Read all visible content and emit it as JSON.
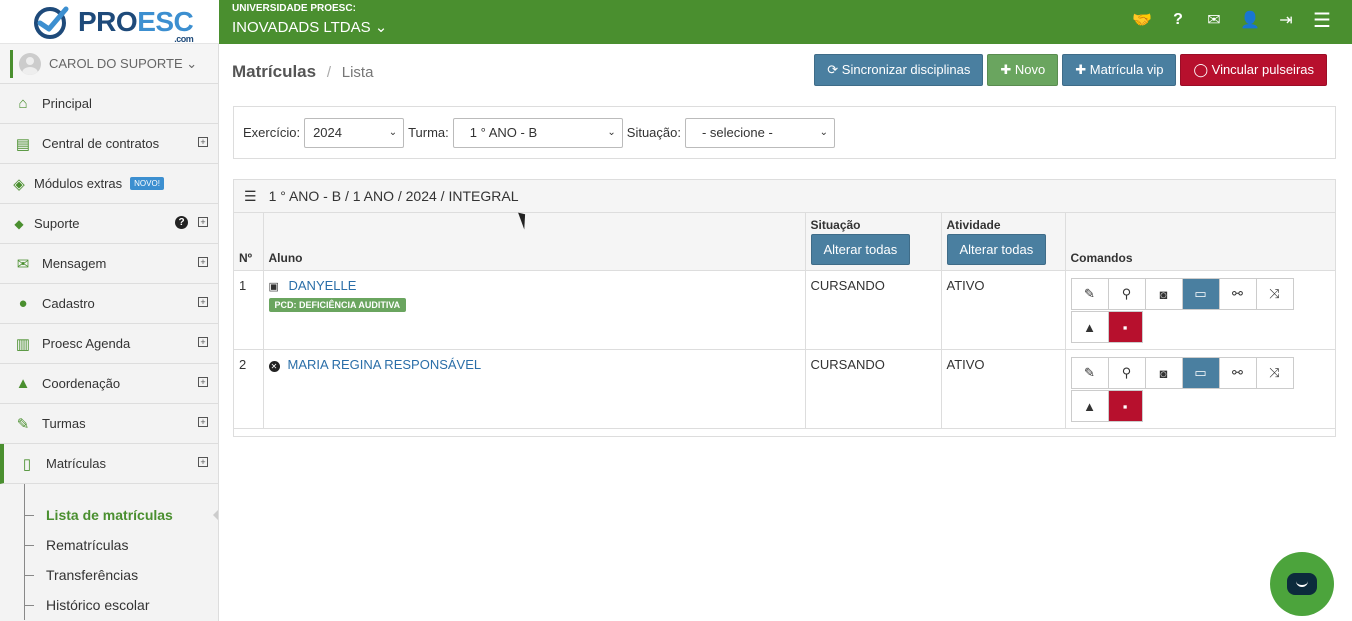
{
  "header": {
    "logo_text_a": "PRO",
    "logo_text_b": "ESC",
    "logo_sub": ".com",
    "org_label": "UNIVERSIDADE PROESC:",
    "org_name": "INOVADADS LTDAS ⌄",
    "icons": [
      "handshake-icon",
      "question-icon",
      "envelope-icon",
      "user-icon",
      "sign-out-icon",
      "menu-icon"
    ],
    "icon_glyphs": [
      "🤝",
      "?",
      "✉",
      "👤",
      "⇥",
      "☰"
    ]
  },
  "sidebar": {
    "user_name": "CAROL DO SUPORTE ⌄",
    "items": [
      {
        "label": "Principal",
        "glyph": "⌂",
        "expand": false
      },
      {
        "label": "Central de contratos",
        "glyph": "▤",
        "expand": true
      },
      {
        "label": "Módulos extras",
        "glyph": "◈",
        "expand": false,
        "badge": "NOVO!"
      },
      {
        "label": "Suporte",
        "glyph": "◆",
        "expand": true,
        "help": "?"
      },
      {
        "label": "Mensagem",
        "glyph": "✉",
        "expand": true
      },
      {
        "label": "Cadastro",
        "glyph": "●",
        "expand": true
      },
      {
        "label": "Proesc Agenda",
        "glyph": "▥",
        "expand": true
      },
      {
        "label": "Coordenação",
        "glyph": "▲",
        "expand": true
      },
      {
        "label": "Turmas",
        "glyph": "✎",
        "expand": true
      },
      {
        "label": "Matrículas",
        "glyph": "▯",
        "expand": true
      }
    ],
    "plus": "+",
    "submenu": [
      "Lista de matrículas",
      "Rematrículas",
      "Transferências",
      "Histórico escolar"
    ]
  },
  "page": {
    "title": "Matrículas",
    "sep": "/",
    "crumb": "Lista"
  },
  "actions": {
    "sync": "⟳ Sincronizar disciplinas",
    "novo": "✚ Novo",
    "vip": "✚ Matrícula vip",
    "pulse": "◯ Vincular pulseiras"
  },
  "filters": {
    "exercicio_label": "Exercício:",
    "exercicio_value": "2024",
    "turma_label": "Turma:",
    "turma_value": "1 ° ANO - B",
    "situacao_label": "Situação:",
    "situacao_value": "- selecione -",
    "caret": "⌄"
  },
  "panel": {
    "list_icon": "☰",
    "title": "1 ° ANO - B / 1 ANO / 2024 / INTEGRAL"
  },
  "table": {
    "col_num": "Nº",
    "col_aluno": "Aluno",
    "col_situacao": "Situação",
    "col_atividade": "Atividade",
    "col_comandos": "Comandos",
    "alterar_situacao": "Alterar todas",
    "alterar_atividade": "Alterar todas",
    "rows": [
      {
        "num": "1",
        "name": "DANYELLE",
        "icon": "▣",
        "pcd": "PCD: DEFICIÊNCIA AUDITIVA",
        "situacao": "CURSANDO",
        "atividade": "ATIVO"
      },
      {
        "num": "2",
        "name": "MARIA REGINA RESPONSÁVEL",
        "icon": "✕",
        "situacao": "CURSANDO",
        "atividade": "ATIVO"
      }
    ],
    "cmd_glyphs": {
      "edit": "✎",
      "search": "⚲",
      "camera": "◙",
      "folder": "▭",
      "handshake": "⚯",
      "shuffle": "⤨",
      "warning": "▲",
      "trash": "▪"
    }
  },
  "colors": {
    "brand_green": "#4a8f2f",
    "button_blue": "#4a7fa0",
    "danger_red": "#b7102d"
  }
}
